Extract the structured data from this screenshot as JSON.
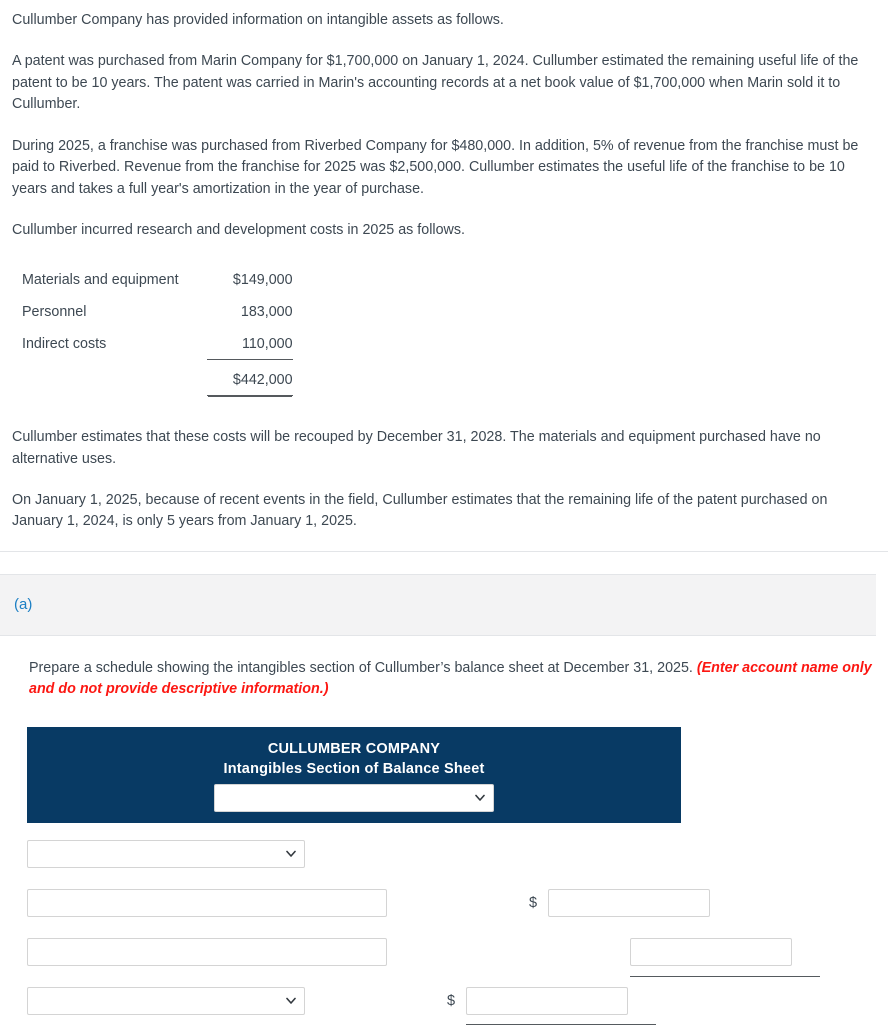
{
  "problem": {
    "paragraphs": [
      "Cullumber Company has provided information on intangible assets as follows.",
      "A patent was purchased from Marin Company for $1,700,000 on January 1, 2024. Cullumber estimated the remaining useful life of the patent to be 10 years. The patent was carried in Marin's accounting records at a net book value of $1,700,000 when Marin sold it to Cullumber.",
      "During 2025, a franchise was purchased from Riverbed Company for $480,000. In addition, 5% of revenue from the franchise must be paid to Riverbed. Revenue from the franchise for 2025 was $2,500,000. Cullumber estimates the useful life of the franchise to be 10 years and takes a full year's amortization in the year of purchase.",
      "Cullumber incurred research and development costs in 2025 as follows."
    ],
    "paragraphs_after_table": [
      "Cullumber estimates that these costs will be recouped by December 31, 2028. The materials and equipment purchased have no alternative uses.",
      "On January 1, 2025, because of recent events in the field, Cullumber estimates that the remaining life of the patent purchased on January 1, 2024, is only 5 years from January 1, 2025."
    ],
    "cost_table": {
      "rows": [
        {
          "label": "Materials and equipment",
          "amount": "$149,000"
        },
        {
          "label": "Personnel",
          "amount": "183,000"
        },
        {
          "label": "Indirect costs",
          "amount": "110,000"
        }
      ],
      "total": {
        "label": "",
        "amount": "$442,000"
      }
    }
  },
  "part": {
    "letter": "(a)",
    "instruction_main": "Prepare a schedule showing the intangibles section of Cullumber’s balance sheet at December 31, 2025. ",
    "instruction_note": "(Enter account name only and do not provide descriptive information.)"
  },
  "worksheet": {
    "company_name": "CULLUMBER COMPANY",
    "statement_name": "Intangibles Section of Balance Sheet",
    "header_period_select": {
      "value": "",
      "placeholder": ""
    },
    "rows": [
      {
        "type": "select",
        "label_value": "",
        "amount_value": "",
        "dollar": ""
      },
      {
        "type": "text",
        "label_value": "",
        "amount_value": "",
        "dollar": "$"
      },
      {
        "type": "text",
        "label_value": "",
        "amount_value": "",
        "dollar": ""
      },
      {
        "type": "select",
        "label_value": "",
        "amount_value": "",
        "dollar": "$"
      }
    ]
  },
  "colors": {
    "header_blue": "#083a64",
    "accent_blue": "#1b7fc4",
    "note_red": "#fc1712",
    "body_text": "#3d4852"
  }
}
